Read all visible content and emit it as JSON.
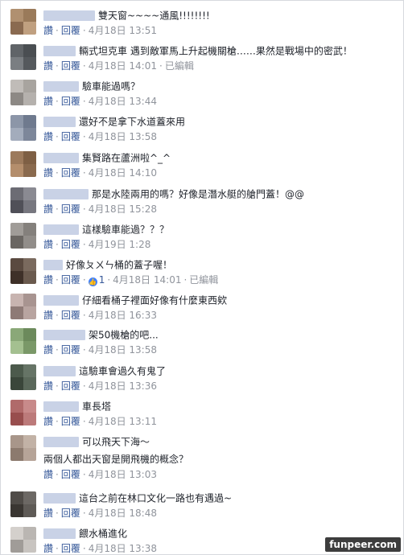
{
  "actions": {
    "like": "讚",
    "reply": "回覆",
    "edited": "已編輯"
  },
  "comments": [
    {
      "text": "雙天窗~~~~通風!!!!!!!!",
      "time": "4月18日 13:51",
      "avatar": [
        "#b09070",
        "#9a7a5a",
        "#8a6a50",
        "#c0a080"
      ]
    },
    {
      "text": "輛式坦克車 遇到敵軍馬上升起機關槍……果然是戰場中的密武！",
      "time": "4月18日 14:01",
      "edited": true,
      "avatar": [
        "#606468",
        "#4a4e52",
        "#7a7e82",
        "#55595d"
      ]
    },
    {
      "text": "驗車能過嗎？",
      "time": "4月18日 13:44",
      "avatar": [
        "#c0bcb8",
        "#a8a49f",
        "#8d8985",
        "#b5b1ad"
      ]
    },
    {
      "text": "還好不是拿下水道蓋來用",
      "time": "4月18日 13:58",
      "avatar": [
        "#8c96a8",
        "#6f7a8e",
        "#a3acbc",
        "#7d879a"
      ]
    },
    {
      "text": "集賢路在蘆洲啦^_^",
      "time": "4月18日 14:10",
      "avatar": [
        "#9c7a5c",
        "#7e5f44",
        "#b48e6c",
        "#8a6a4e"
      ]
    },
    {
      "text": "那是水陸兩用的嗎？好像是潛水艇的艙門蓋！@@",
      "time": "4月18日 15:28",
      "avatar": [
        "#6c6c74",
        "#8a8a92",
        "#505058",
        "#77777f"
      ]
    },
    {
      "text": "這樣驗車能過？？？",
      "time": "4月19日 1:28",
      "avatar": [
        "#a09c98",
        "#84807c",
        "#6a6662",
        "#918d89"
      ]
    },
    {
      "text": "好像ㄆㄨㄣ桶的蓋子喔！",
      "time": "4月18日 14:01",
      "likes": "1",
      "edited": true,
      "avatar": [
        "#5a4a40",
        "#7a6a5e",
        "#3e3028",
        "#6a5a4e"
      ]
    },
    {
      "text": "仔細看桶子裡面好像有什麼東西欸",
      "time": "4月18日 16:33",
      "avatar": [
        "#c8b4b0",
        "#a89490",
        "#8e7a76",
        "#b8a4a0"
      ]
    },
    {
      "text": "架50機槍的吧...",
      "time": "4月18日 13:58",
      "avatar": [
        "#8aa878",
        "#6c8a5c",
        "#a4c090",
        "#7a9868"
      ]
    },
    {
      "text": "這驗車會過久有鬼了",
      "time": "4月18日 13:36",
      "avatar": [
        "#4c5a4c",
        "#667466",
        "#3a463a",
        "#5a685a"
      ]
    },
    {
      "text": "車長塔",
      "time": "4月18日 13:11",
      "avatar": [
        "#b06a6a",
        "#c88a8a",
        "#984e4e",
        "#bc7a7a"
      ]
    },
    {
      "text": "可以飛天下海～",
      "extra": "兩個人都出天窗是開飛機的概念？",
      "time": "4月18日 13:03",
      "avatar": [
        "#a8968a",
        "#c2b2a6",
        "#8c7a6e",
        "#b6a498"
      ]
    },
    {
      "text": "這台之前在林口文化一路也有遇過~",
      "time": "4月18日 18:48",
      "avatar": [
        "#504c48",
        "#6c6864",
        "#3a3632",
        "#5e5a56"
      ]
    },
    {
      "text": "餵水桶進化",
      "time": "4月18日 13:38",
      "avatar": [
        "#d4d0cc",
        "#bab6b2",
        "#a09c98",
        "#c8c4c0"
      ]
    }
  ],
  "watermark": "funpeer.com"
}
